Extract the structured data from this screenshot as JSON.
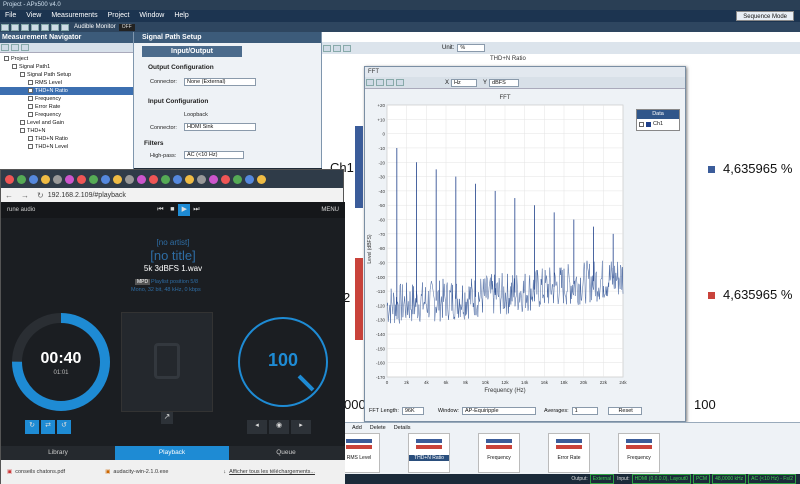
{
  "app": {
    "title": "Project - APx500 v4.0",
    "menu": [
      "File",
      "View",
      "Measurements",
      "Project",
      "Window",
      "Help"
    ],
    "sequence_mode": "Sequence Mode",
    "audible_monitor": "Audible Monitor",
    "audible_state": "OFF"
  },
  "nav": {
    "title": "Measurement Navigator",
    "items": [
      {
        "label": "Project",
        "level": 0
      },
      {
        "label": "Signal Path1",
        "level": 1
      },
      {
        "label": "Signal Path Setup",
        "level": 2
      },
      {
        "label": "RMS Level",
        "level": 3
      },
      {
        "label": "THD+N Ratio",
        "level": 3,
        "selected": true
      },
      {
        "label": "Frequency",
        "level": 3
      },
      {
        "label": "Error Rate",
        "level": 3
      },
      {
        "label": "Frequency",
        "level": 3
      },
      {
        "label": "Level and Gain",
        "level": 2
      },
      {
        "label": "THD+N",
        "level": 2
      },
      {
        "label": "THD+N Ratio",
        "level": 3
      },
      {
        "label": "THD+N Level",
        "level": 3
      }
    ]
  },
  "sps": {
    "title": "Signal Path Setup",
    "tab": "Input/Output",
    "output_title": "Output Configuration",
    "connector_label": "Connector:",
    "output_connector": "None (External)",
    "input_title": "Input Configuration",
    "loopback": "Loopback",
    "input_connector": "HDMI Sink",
    "filters_title": "Filters",
    "highpass_label": "High-pass:",
    "highpass_value": "AC (<10 Hz)"
  },
  "right": {
    "unit_label": "Unit:",
    "unit_value": "%",
    "graph_title": "THD+N Ratio",
    "ch1_label": "Ch1",
    "ch2_label": "2",
    "ch1_value": "4,635965",
    "ch2_value": "4,635965",
    "pct": "%",
    "axis_left": "000",
    "axis_right": "100"
  },
  "fft": {
    "window_title": "FFT",
    "x_unit": "Hz",
    "y_unit": "dBFS",
    "title": "FFT",
    "ylabel": "Level (dBFS)",
    "xlabel": "Frequency (Hz)",
    "legend_title": "Data",
    "legend_item": "Ch1",
    "fft_length_label": "FFT Length:",
    "fft_length": "96K",
    "window_label": "Window:",
    "window_value": "AP-Equiripple",
    "averages_label": "Averages:",
    "averages_value": "1",
    "reset": "Reset"
  },
  "chart_data": {
    "type": "line",
    "title": "FFT",
    "xlabel": "Frequency (Hz)",
    "ylabel": "Level (dBFS)",
    "xlim": [
      0,
      24000
    ],
    "ylim": [
      -170,
      20
    ],
    "x_ticks": [
      "0",
      "2k",
      "4k",
      "6k",
      "8k",
      "10k",
      "12k",
      "14k",
      "16k",
      "18k",
      "20k",
      "22k",
      "24k"
    ],
    "y_ticks": [
      20,
      10,
      0,
      -10,
      -20,
      -30,
      -40,
      -50,
      -60,
      -70,
      -80,
      -90,
      -100,
      -110,
      -120,
      -130,
      -140,
      -150,
      -160,
      -170
    ],
    "series": [
      {
        "name": "Ch1",
        "peaks": [
          {
            "x": 1000,
            "y": -10
          },
          {
            "x": 3000,
            "y": -20
          },
          {
            "x": 5000,
            "y": -25
          },
          {
            "x": 7000,
            "y": -30
          },
          {
            "x": 9000,
            "y": -35
          },
          {
            "x": 11000,
            "y": -40
          },
          {
            "x": 13000,
            "y": -45
          },
          {
            "x": 15000,
            "y": -50
          },
          {
            "x": 17000,
            "y": -55
          },
          {
            "x": 19000,
            "y": -60
          },
          {
            "x": 21000,
            "y": -65
          },
          {
            "x": 23000,
            "y": -70
          }
        ],
        "noise_floor": [
          {
            "x": 0,
            "y": -120
          },
          {
            "x": 12000,
            "y": -112
          },
          {
            "x": 24000,
            "y": -100
          }
        ]
      }
    ]
  },
  "bottom": {
    "toolbar": [
      "Add",
      "Delete",
      "Details"
    ],
    "thumbs": [
      "RMS Level",
      "THD+N Ratio",
      "Frequency",
      "Error Rate",
      "Frequency"
    ],
    "status": [
      "Output:",
      "External",
      "Input:",
      "HDMI (0.0.0.0), Layout0",
      "PCM",
      "48,0000 kHz",
      "AC (<10 Hz) - Fs/2"
    ]
  },
  "browser": {
    "url": "192.168.2.109/#playback",
    "brand": "rune audio",
    "menu": "MENU",
    "artist": "[no artist]",
    "title": "[no title]",
    "file": "5k  3dBFS 1.wav",
    "mpd": "MPD",
    "playlist": "Playlist position 5/8",
    "format": "Mono, 32 bit, 48 kHz, 0 kbps",
    "time": "00:40",
    "elapsed": "01:01",
    "volume": "100",
    "tabs": [
      "Library",
      "Playback",
      "Queue"
    ],
    "downloads": [
      "conseils chatons.pdf",
      "audacity-win-2.1.0.exe",
      "Afficher tous les téléchargements..."
    ],
    "colors": {
      "accent": "#1e8bd4",
      "panel": "#1b1e22"
    }
  }
}
